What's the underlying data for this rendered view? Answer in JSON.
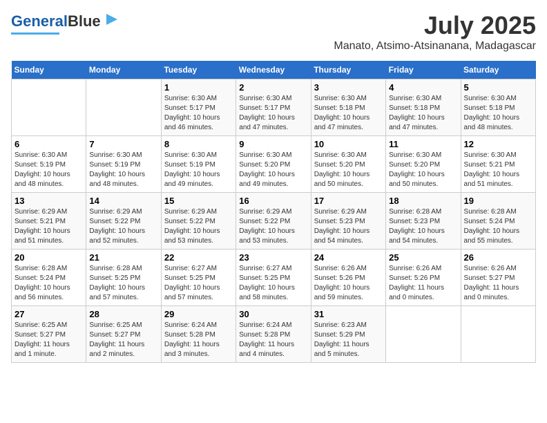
{
  "logo": {
    "text1": "General",
    "text2": "Blue"
  },
  "title": "July 2025",
  "subtitle": "Manato, Atsimo-Atsinanana, Madagascar",
  "weekdays": [
    "Sunday",
    "Monday",
    "Tuesday",
    "Wednesday",
    "Thursday",
    "Friday",
    "Saturday"
  ],
  "weeks": [
    [
      {
        "day": "",
        "info": ""
      },
      {
        "day": "",
        "info": ""
      },
      {
        "day": "1",
        "info": "Sunrise: 6:30 AM\nSunset: 5:17 PM\nDaylight: 10 hours\nand 46 minutes."
      },
      {
        "day": "2",
        "info": "Sunrise: 6:30 AM\nSunset: 5:17 PM\nDaylight: 10 hours\nand 47 minutes."
      },
      {
        "day": "3",
        "info": "Sunrise: 6:30 AM\nSunset: 5:18 PM\nDaylight: 10 hours\nand 47 minutes."
      },
      {
        "day": "4",
        "info": "Sunrise: 6:30 AM\nSunset: 5:18 PM\nDaylight: 10 hours\nand 47 minutes."
      },
      {
        "day": "5",
        "info": "Sunrise: 6:30 AM\nSunset: 5:18 PM\nDaylight: 10 hours\nand 48 minutes."
      }
    ],
    [
      {
        "day": "6",
        "info": "Sunrise: 6:30 AM\nSunset: 5:19 PM\nDaylight: 10 hours\nand 48 minutes."
      },
      {
        "day": "7",
        "info": "Sunrise: 6:30 AM\nSunset: 5:19 PM\nDaylight: 10 hours\nand 48 minutes."
      },
      {
        "day": "8",
        "info": "Sunrise: 6:30 AM\nSunset: 5:19 PM\nDaylight: 10 hours\nand 49 minutes."
      },
      {
        "day": "9",
        "info": "Sunrise: 6:30 AM\nSunset: 5:20 PM\nDaylight: 10 hours\nand 49 minutes."
      },
      {
        "day": "10",
        "info": "Sunrise: 6:30 AM\nSunset: 5:20 PM\nDaylight: 10 hours\nand 50 minutes."
      },
      {
        "day": "11",
        "info": "Sunrise: 6:30 AM\nSunset: 5:20 PM\nDaylight: 10 hours\nand 50 minutes."
      },
      {
        "day": "12",
        "info": "Sunrise: 6:30 AM\nSunset: 5:21 PM\nDaylight: 10 hours\nand 51 minutes."
      }
    ],
    [
      {
        "day": "13",
        "info": "Sunrise: 6:29 AM\nSunset: 5:21 PM\nDaylight: 10 hours\nand 51 minutes."
      },
      {
        "day": "14",
        "info": "Sunrise: 6:29 AM\nSunset: 5:22 PM\nDaylight: 10 hours\nand 52 minutes."
      },
      {
        "day": "15",
        "info": "Sunrise: 6:29 AM\nSunset: 5:22 PM\nDaylight: 10 hours\nand 53 minutes."
      },
      {
        "day": "16",
        "info": "Sunrise: 6:29 AM\nSunset: 5:22 PM\nDaylight: 10 hours\nand 53 minutes."
      },
      {
        "day": "17",
        "info": "Sunrise: 6:29 AM\nSunset: 5:23 PM\nDaylight: 10 hours\nand 54 minutes."
      },
      {
        "day": "18",
        "info": "Sunrise: 6:28 AM\nSunset: 5:23 PM\nDaylight: 10 hours\nand 54 minutes."
      },
      {
        "day": "19",
        "info": "Sunrise: 6:28 AM\nSunset: 5:24 PM\nDaylight: 10 hours\nand 55 minutes."
      }
    ],
    [
      {
        "day": "20",
        "info": "Sunrise: 6:28 AM\nSunset: 5:24 PM\nDaylight: 10 hours\nand 56 minutes."
      },
      {
        "day": "21",
        "info": "Sunrise: 6:28 AM\nSunset: 5:25 PM\nDaylight: 10 hours\nand 57 minutes."
      },
      {
        "day": "22",
        "info": "Sunrise: 6:27 AM\nSunset: 5:25 PM\nDaylight: 10 hours\nand 57 minutes."
      },
      {
        "day": "23",
        "info": "Sunrise: 6:27 AM\nSunset: 5:25 PM\nDaylight: 10 hours\nand 58 minutes."
      },
      {
        "day": "24",
        "info": "Sunrise: 6:26 AM\nSunset: 5:26 PM\nDaylight: 10 hours\nand 59 minutes."
      },
      {
        "day": "25",
        "info": "Sunrise: 6:26 AM\nSunset: 5:26 PM\nDaylight: 11 hours\nand 0 minutes."
      },
      {
        "day": "26",
        "info": "Sunrise: 6:26 AM\nSunset: 5:27 PM\nDaylight: 11 hours\nand 0 minutes."
      }
    ],
    [
      {
        "day": "27",
        "info": "Sunrise: 6:25 AM\nSunset: 5:27 PM\nDaylight: 11 hours\nand 1 minute."
      },
      {
        "day": "28",
        "info": "Sunrise: 6:25 AM\nSunset: 5:27 PM\nDaylight: 11 hours\nand 2 minutes."
      },
      {
        "day": "29",
        "info": "Sunrise: 6:24 AM\nSunset: 5:28 PM\nDaylight: 11 hours\nand 3 minutes."
      },
      {
        "day": "30",
        "info": "Sunrise: 6:24 AM\nSunset: 5:28 PM\nDaylight: 11 hours\nand 4 minutes."
      },
      {
        "day": "31",
        "info": "Sunrise: 6:23 AM\nSunset: 5:29 PM\nDaylight: 11 hours\nand 5 minutes."
      },
      {
        "day": "",
        "info": ""
      },
      {
        "day": "",
        "info": ""
      }
    ]
  ]
}
